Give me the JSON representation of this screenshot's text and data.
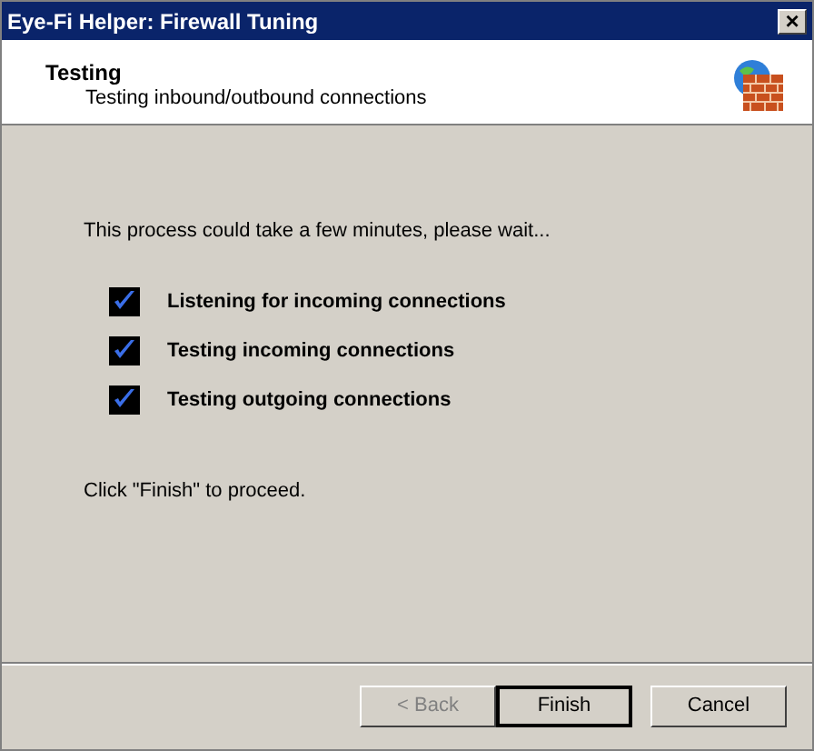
{
  "window": {
    "title": "Eye-Fi Helper: Firewall Tuning",
    "close": "×"
  },
  "header": {
    "title": "Testing",
    "subtitle": "Testing inbound/outbound connections"
  },
  "intro": "This process could take a few minutes, please wait...",
  "steps": [
    {
      "label": "Listening for incoming connections",
      "checked": true
    },
    {
      "label": "Testing incoming connections",
      "checked": true
    },
    {
      "label": "Testing outgoing connections",
      "checked": true
    }
  ],
  "footer_note": "Click \"Finish\" to proceed.",
  "buttons": [
    {
      "label": "< Back",
      "disabled": true,
      "default": false
    },
    {
      "label": "Finish",
      "disabled": false,
      "default": true
    },
    {
      "label": "Cancel",
      "disabled": false,
      "default": false
    }
  ]
}
